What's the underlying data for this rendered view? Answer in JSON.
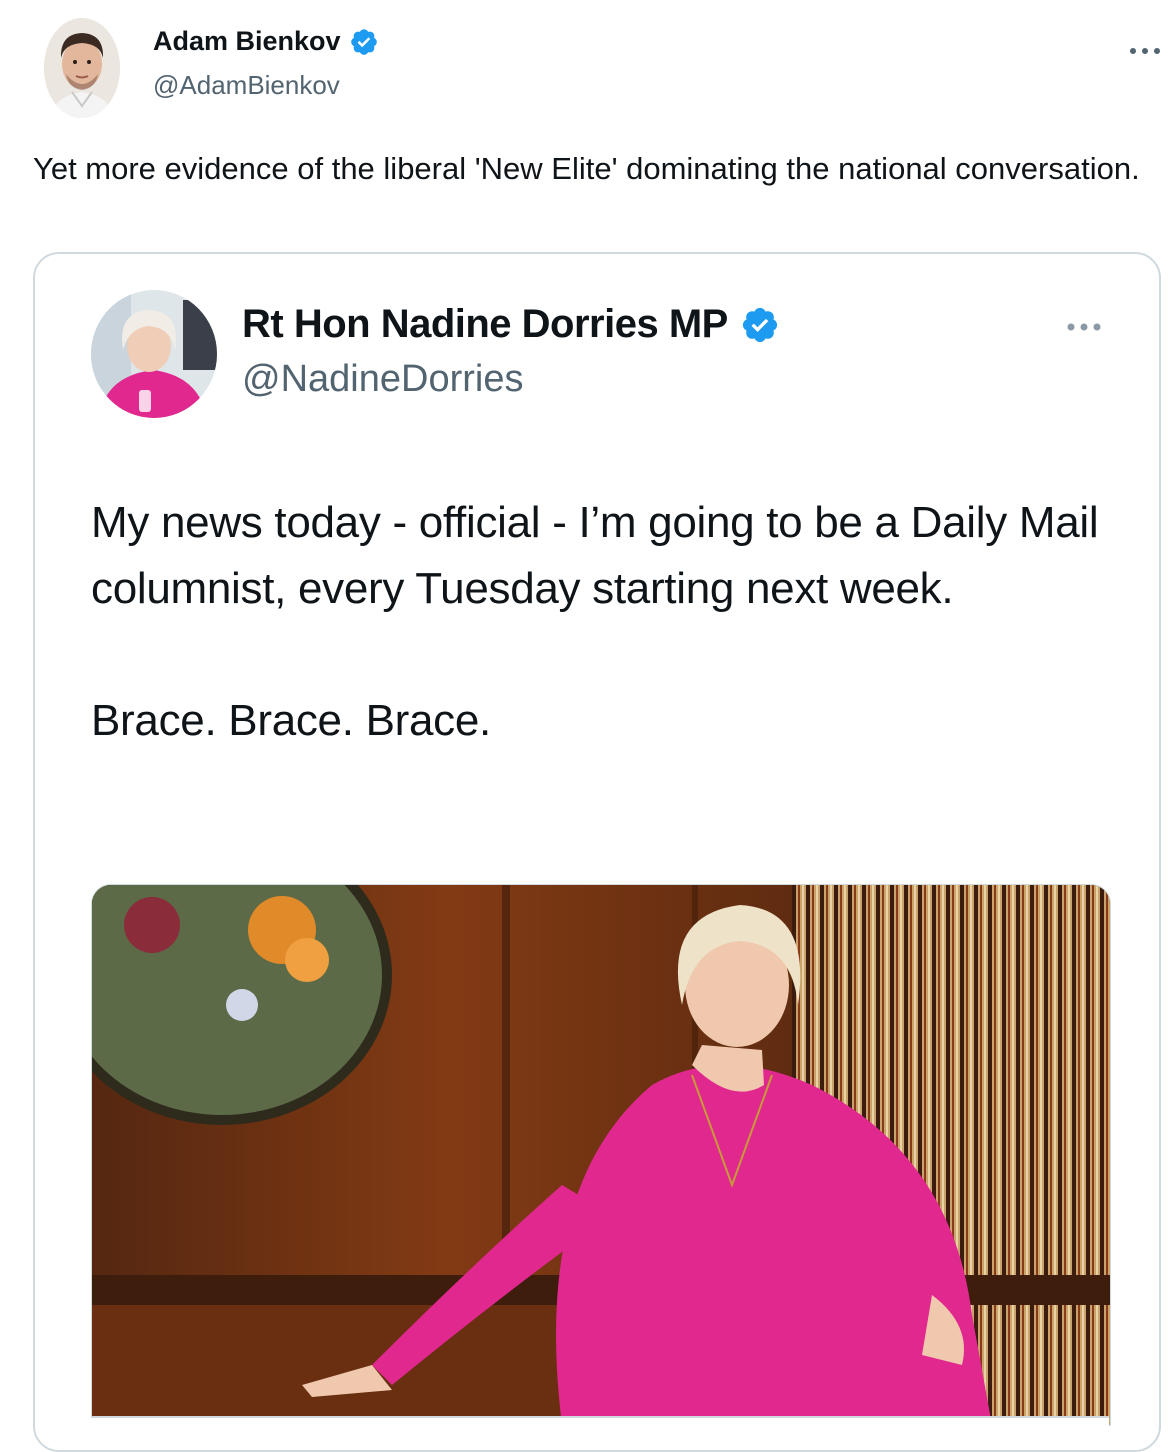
{
  "tweet": {
    "author": {
      "name": "Adam Bienkov",
      "handle": "@AdamBienkov",
      "verified": true
    },
    "more_icon": "more-horizontal-icon",
    "text": "Yet more evidence of the liberal 'New Elite' dominating the national conversation."
  },
  "quoted_tweet": {
    "author": {
      "name": "Rt Hon Nadine Dorries MP",
      "handle": "@NadineDorries",
      "verified": true
    },
    "more_icon": "more-horizontal-icon",
    "paragraphs": [
      "My news today - official - I’m going to be a Daily Mail columnist, every Tuesday starting next week.",
      "Brace. Brace. Brace."
    ]
  },
  "colors": {
    "verified_badge": "#1d9bf0",
    "primary_text": "#0f1419",
    "secondary_text": "#536471",
    "border": "#cfd9de",
    "dress_pink": "#e0288e"
  }
}
